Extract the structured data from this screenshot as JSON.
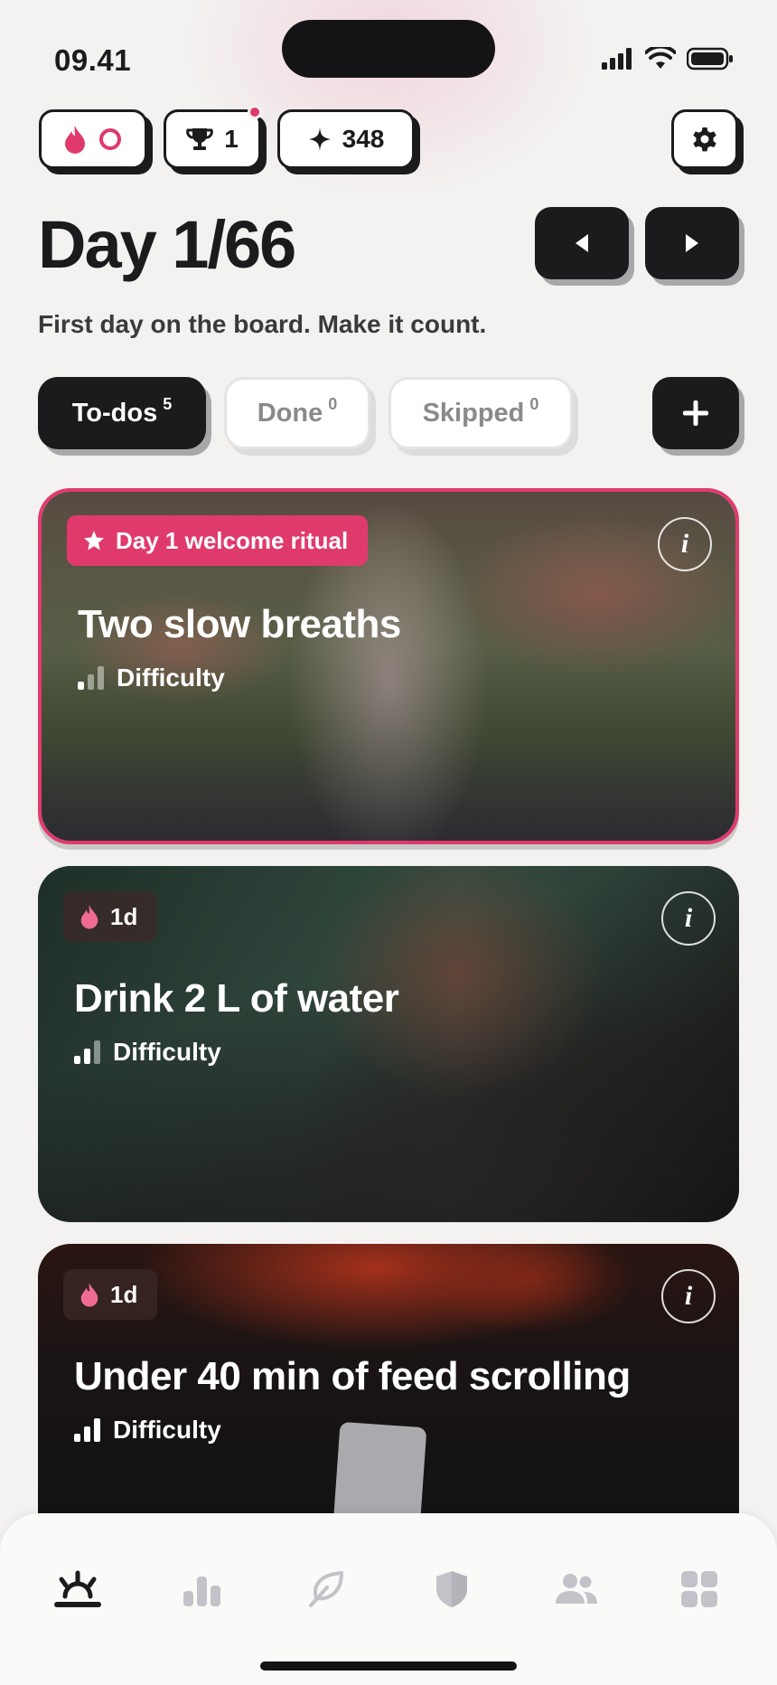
{
  "status": {
    "time": "09.41"
  },
  "header": {
    "streak_value": "",
    "trophy_count": "1",
    "points": "348"
  },
  "day": {
    "title": "Day 1/66",
    "subtitle": "First day on the board. Make it count."
  },
  "tabs": [
    {
      "label": "To-dos",
      "count": "5"
    },
    {
      "label": "Done",
      "count": "0"
    },
    {
      "label": "Skipped",
      "count": "0"
    }
  ],
  "cards": [
    {
      "badge": "Day 1 welcome ritual",
      "title": "Two slow breaths",
      "difficulty_label": "Difficulty",
      "difficulty_level": 1,
      "info": "i"
    },
    {
      "badge": "1d",
      "title": "Drink 2 L of water",
      "difficulty_label": "Difficulty",
      "difficulty_level": 2,
      "info": "i"
    },
    {
      "badge": "1d",
      "title": "Under 40 min of feed scrolling",
      "difficulty_label": "Difficulty",
      "difficulty_level": 3,
      "info": "i"
    }
  ],
  "bottom_nav": [
    "today-icon",
    "stats-icon",
    "leaf-icon",
    "shield-icon",
    "community-icon",
    "grid-icon"
  ],
  "colors": {
    "accent": "#e03a6d",
    "dark": "#1b1b1d",
    "background": "#f3f2f0"
  }
}
